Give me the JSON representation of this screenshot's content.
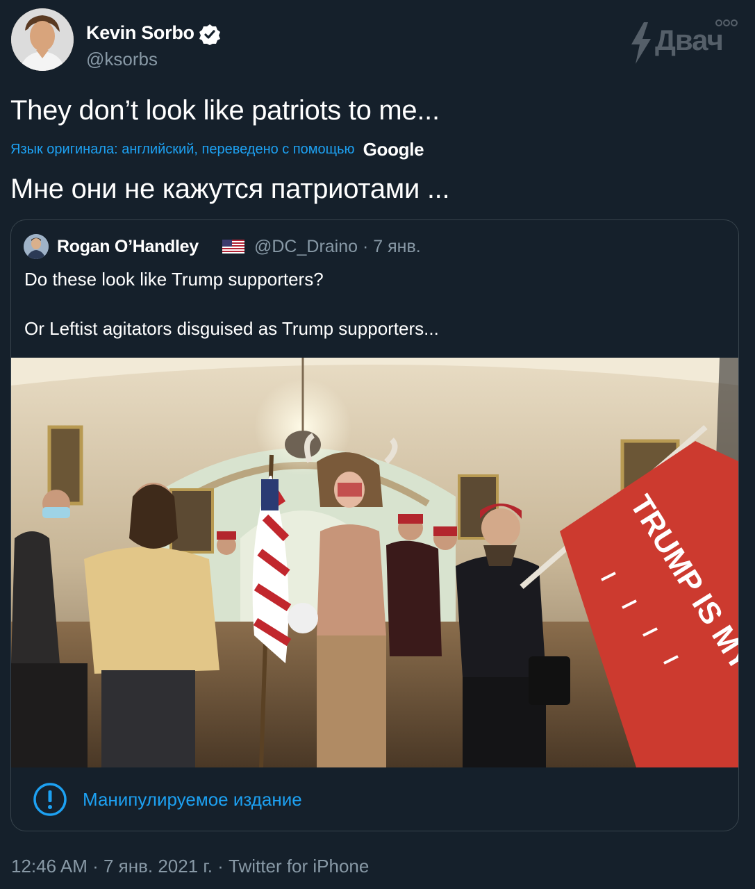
{
  "tweet": {
    "author": {
      "name": "Kevin Sorbo",
      "handle": "@ksorbs",
      "verified_icon": "verified-badge-icon"
    },
    "text": "They don’t look like patriots to me...",
    "translation_note": "Язык оригинала: английский, переведено с помощью",
    "translation_provider": "Google",
    "translated_text": "Мне они не кажутся патриотами ...",
    "quoted": {
      "author_name": "Rogan O’Handley",
      "flag_icon": "us-flag-icon",
      "meta": "@DC_Draino · 7 янв.",
      "text_line1": "Do these look like Trump supporters?",
      "text_line2": "Or Leftist agitators disguised as Trump supporters...",
      "photo_flag_text": "TRUMP IS MY PRESIDENT",
      "notice_icon": "exclamation-circle-icon",
      "notice_label": "Манипулируемое издание"
    },
    "footer": "12:46 AM · 7 янв. 2021 г. · Twitter for iPhone"
  },
  "watermark": {
    "text": "Двач",
    "icon": "lightning-bolt-icon"
  },
  "colors": {
    "background": "#15202b",
    "link_blue": "#1da1f2",
    "muted": "#8899a6",
    "border": "#38444d"
  }
}
